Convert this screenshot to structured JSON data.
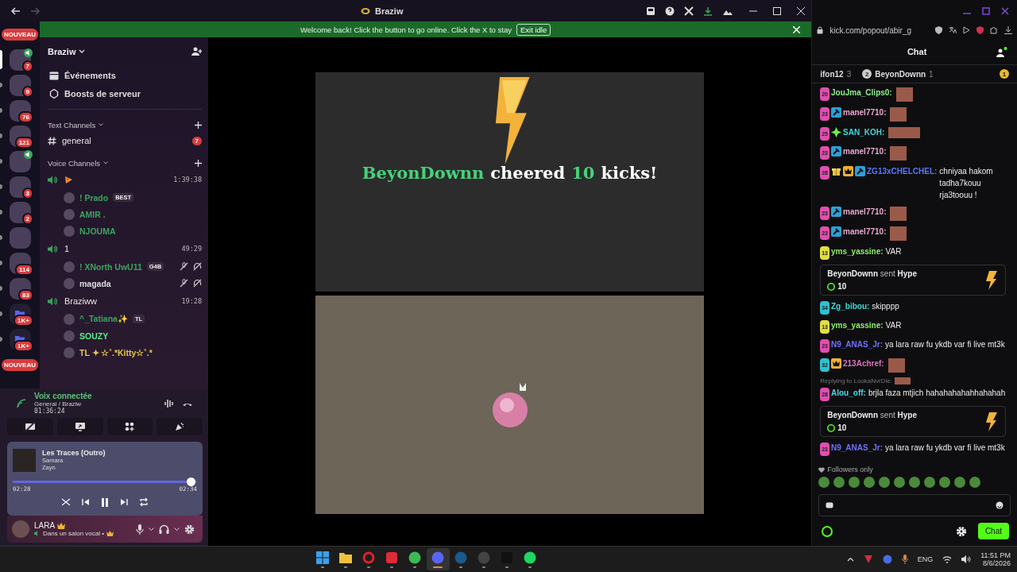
{
  "titlebar": {
    "title": "Braziw"
  },
  "banner": {
    "text": "Welcome back! Click the button to go online. Click the X to stay",
    "button": "Exit idle"
  },
  "servers": [
    {
      "kind": "new",
      "label": "NOUVEAU"
    },
    {
      "kind": "server",
      "badge": "7",
      "voice": true,
      "selected": true
    },
    {
      "kind": "server",
      "badge": "9",
      "voice": false,
      "selected": false
    },
    {
      "kind": "server",
      "badge": "76",
      "voice": false,
      "selected": false
    },
    {
      "kind": "server",
      "badge": "121",
      "voice": false,
      "selected": false
    },
    {
      "kind": "server",
      "voice": true,
      "selected": false
    },
    {
      "kind": "server",
      "badge": "3",
      "voice": false,
      "selected": false
    },
    {
      "kind": "server",
      "badge": "2",
      "voice": false,
      "selected": false
    },
    {
      "kind": "server",
      "voice": false,
      "selected": false
    },
    {
      "kind": "server",
      "badge": "114",
      "voice": false,
      "selected": false
    },
    {
      "kind": "server",
      "badge": "83",
      "voice": false,
      "selected": false
    },
    {
      "kind": "folder",
      "badge": "1K+",
      "voice": false,
      "selected": false
    },
    {
      "kind": "folder",
      "badge": "1K+",
      "voice": false,
      "selected": false
    },
    {
      "kind": "new",
      "label": "NOUVEAU"
    }
  ],
  "server_header": {
    "name": "Braziw"
  },
  "menu": [
    {
      "kind": "events",
      "label": "Événements"
    },
    {
      "kind": "boost",
      "label": "Boosts de serveur"
    }
  ],
  "text_category": {
    "label": "Text Channels",
    "channels": [
      {
        "name": "general",
        "badge": "7"
      }
    ]
  },
  "voice_category": {
    "label": "Voice Channels",
    "channels": [
      {
        "timer": "1:39:38",
        "members": [
          {
            "name": "! Prado",
            "color": "#3ba55d",
            "tag": "BEST",
            "muted": false,
            "deafened": false
          },
          {
            "name": "AMIR .",
            "color": "#3ba55d",
            "muted": false,
            "deafened": false
          },
          {
            "name": "NJOUMA",
            "color": "#3ba55d",
            "muted": false,
            "deafened": false
          }
        ]
      },
      {
        "name": "1",
        "timer": "49:29",
        "members": [
          {
            "name": "! XNorth UwU11",
            "color": "#3ba55d",
            "tag": "G4B",
            "muted": true,
            "deafened": true
          },
          {
            "name": "magada",
            "color": "#dbdee1",
            "muted": true,
            "deafened": true
          }
        ]
      },
      {
        "name": "Braziww",
        "timer": "19:28",
        "members": [
          {
            "name": "^_Tatiana✨",
            "color": "#3ba55d",
            "tag": "TL",
            "muted": false,
            "deafened": false
          },
          {
            "name": "SOUZY",
            "color": "#57f287",
            "muted": false,
            "deafened": false
          },
          {
            "name": "TL ✦ ☆˚.*Kitty☆˚.*",
            "color": "#e8c94a",
            "muted": false,
            "deafened": false
          }
        ]
      }
    ]
  },
  "voice_panel": {
    "status": "Voix connectée",
    "channel": "General / Braziw",
    "timer": "01:36:24"
  },
  "music": {
    "title": "Les Traces (Outro)",
    "artists": [
      "Samara",
      "Zayn"
    ],
    "level": 0.97,
    "elapsed": "02:28",
    "duration": "02:34",
    "playing": true
  },
  "user": {
    "name": "LARA",
    "status": "Dans un salon vocal •"
  },
  "stage": {
    "alert": {
      "name": "BeyonDownn",
      "action": "cheered",
      "amount": "10",
      "unit": "kicks!"
    }
  },
  "browser": {
    "url": "kick.com/popout/abir_g"
  },
  "chat": {
    "title": "Chat",
    "leaderboard": [
      {
        "name": "ifon12",
        "count": "3"
      },
      {
        "rank": "2",
        "name": "BeyonDownn",
        "count": "1"
      },
      {
        "rank": "1"
      }
    ],
    "messages": [
      {
        "kind": "message",
        "badge": {
          "text": "20",
          "color": "#e04fb0"
        },
        "user": {
          "name": "JouJma_Clips0:",
          "color": "#8ef08e"
        },
        "emote": true
      },
      {
        "kind": "message",
        "badge": {
          "text": "23",
          "color": "#e04fb0"
        },
        "badges": [
          {
            "kind": "mod"
          }
        ],
        "user": {
          "name": "manel7710:",
          "color": "#e8a8cc"
        },
        "emote": true
      },
      {
        "kind": "message",
        "badge": {
          "text": "25",
          "color": "#e04fb0"
        },
        "badges": [
          {
            "kind": "diamond"
          }
        ],
        "user": {
          "name": "SAN_KOH:",
          "color": "#3fd8d8"
        },
        "emote": true,
        "wide": true
      },
      {
        "kind": "message",
        "badge": {
          "text": "23",
          "color": "#e04fb0"
        },
        "badges": [
          {
            "kind": "mod"
          }
        ],
        "user": {
          "name": "manel7710:",
          "color": "#e8a8cc"
        },
        "emote": true
      },
      {
        "kind": "message",
        "badge": {
          "text": "28",
          "color": "#e04fb0"
        },
        "badges": [
          {
            "kind": "gift"
          },
          {
            "kind": "crown"
          },
          {
            "kind": "mod"
          }
        ],
        "user": {
          "name": "ZG13xCHELCHEL:",
          "color": "#5a78ff"
        },
        "text": "chniyaa hakom tadha7kouu rja3toouu !"
      },
      {
        "kind": "message",
        "badge": {
          "text": "23",
          "color": "#e04fb0"
        },
        "badges": [
          {
            "kind": "mod"
          }
        ],
        "user": {
          "name": "manel7710:",
          "color": "#e8a8cc"
        },
        "emote": true
      },
      {
        "kind": "message",
        "badge": {
          "text": "23",
          "color": "#e04fb0"
        },
        "badges": [
          {
            "kind": "mod"
          }
        ],
        "user": {
          "name": "manel7710:",
          "color": "#e8a8cc"
        },
        "emote": true
      },
      {
        "kind": "message",
        "badge": {
          "text": "13",
          "color": "#e0e040"
        },
        "user": {
          "name": "yms_yassine:",
          "color": "#8ef06a"
        },
        "text": "VAR"
      },
      {
        "kind": "gift",
        "line": "**BeyonDownn** sent **Hype**",
        "amount": "10"
      },
      {
        "kind": "message",
        "badge": {
          "text": "34",
          "color": "#2fc0d0"
        },
        "user": {
          "name": "Zg_bibou:",
          "color": "#3fd8d8"
        },
        "text": "skipppp"
      },
      {
        "kind": "message",
        "badge": {
          "text": "13",
          "color": "#e0e040"
        },
        "user": {
          "name": "yms_yassine:",
          "color": "#8ef06a"
        },
        "text": "VAR"
      },
      {
        "kind": "message",
        "badge": {
          "text": "23",
          "color": "#e04fb0"
        },
        "user": {
          "name": "N9_ANAS_Jr:",
          "color": "#7070ff"
        },
        "text": "ya lara raw fu ykdb var fi live mt3k"
      },
      {
        "kind": "message",
        "badge": {
          "text": "32",
          "color": "#2fc0d0"
        },
        "badges": [
          {
            "kind": "crown"
          }
        ],
        "user": {
          "name": "213Achref:",
          "color": "#e070c0"
        },
        "emote": true
      },
      {
        "kind": "message",
        "reply": "Replying to LookaNvrDie:",
        "badge": {
          "text": "28",
          "color": "#e04fb0"
        },
        "user": {
          "name": "Alou_off:",
          "color": "#4fd8e8"
        },
        "text": "brjla faza mtjich hahahahahahhahahah"
      },
      {
        "kind": "gift",
        "line": "**BeyonDownn** sent **Hype**",
        "amount": "10"
      },
      {
        "kind": "message",
        "badge": {
          "text": "23",
          "color": "#e04fb0"
        },
        "user": {
          "name": "N9_ANAS_Jr:",
          "color": "#7070ff"
        },
        "text": "ya lara raw fu ykdb var fi live mt3k"
      }
    ],
    "mode": "Followers only",
    "send_button": "Chat"
  },
  "taskbar": {
    "apps": [
      {
        "kind": "start",
        "selected": false
      },
      {
        "kind": "files",
        "selected": false
      },
      {
        "kind": "opera",
        "selected": false
      },
      {
        "kind": "wps",
        "selected": false
      },
      {
        "kind": "chrome",
        "selected": false
      },
      {
        "kind": "discord",
        "selected": true
      },
      {
        "kind": "steam",
        "selected": false
      },
      {
        "kind": "obs",
        "selected": false
      },
      {
        "kind": "terminal",
        "selected": false
      },
      {
        "kind": "spotify",
        "selected": false
      }
    ],
    "language": "ENG",
    "time": "11:51 PM",
    "date": "8/6/2026"
  }
}
